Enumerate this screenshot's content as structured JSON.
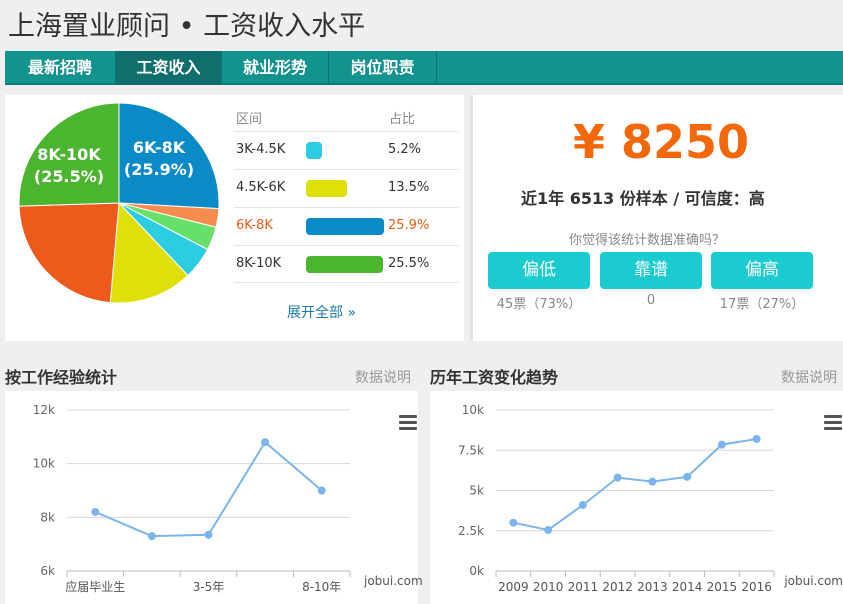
{
  "page": {
    "title": "上海置业顾问 • 工资收入水平"
  },
  "tabs": [
    {
      "label": "最新招聘",
      "active": false
    },
    {
      "label": "工资收入",
      "active": true
    },
    {
      "label": "就业形势",
      "active": false
    },
    {
      "label": "岗位职责",
      "active": false
    }
  ],
  "distribution": {
    "header_range": "区间",
    "header_pct": "占比",
    "rows": [
      {
        "label": "3K-4.5K",
        "pct": "5.2%",
        "value": 5.2,
        "color": "#2ccde0",
        "highlight": false
      },
      {
        "label": "4.5K-6K",
        "pct": "13.5%",
        "value": 13.5,
        "color": "#dfe00a",
        "highlight": false
      },
      {
        "label": "6K-8K",
        "pct": "25.9%",
        "value": 25.9,
        "color": "#0a8ac7",
        "highlight": true
      },
      {
        "label": "8K-10K",
        "pct": "25.5%",
        "value": 25.5,
        "color": "#4bb52f",
        "highlight": false
      }
    ],
    "expand_link": "展开全部 »"
  },
  "chart_data": [
    {
      "type": "pie",
      "slices": [
        {
          "label": "6K-8K",
          "value": 25.9,
          "color": "#0a8ac7"
        },
        {
          "label": "",
          "value": 3.0,
          "color": "#f88c4e"
        },
        {
          "label": "",
          "value": 3.8,
          "color": "#67e06a"
        },
        {
          "label": "3K-4.5K",
          "value": 5.2,
          "color": "#2ccde0"
        },
        {
          "label": "4.5K-6K",
          "value": 13.5,
          "color": "#dfe00a"
        },
        {
          "label": "",
          "value": 23.1,
          "color": "#ed5a1c"
        },
        {
          "label": "8K-10K",
          "value": 25.5,
          "color": "#4bb52f"
        }
      ],
      "data_labels": [
        {
          "line1": "6K-8K",
          "line2": "(25.9%)"
        },
        {
          "line1": "8K-10K",
          "line2": "(25.5%)"
        }
      ]
    },
    {
      "type": "line",
      "title": "按工作经验统计",
      "categories": [
        "应届毕业生",
        "",
        "3-5年",
        "",
        "8-10年"
      ],
      "values": [
        8200,
        7300,
        7350,
        10800,
        9000
      ],
      "ylim": [
        6000,
        12000
      ],
      "yticks": [
        6000,
        8000,
        10000,
        12000
      ],
      "ytick_labels": [
        "6k",
        "8k",
        "10k",
        "12k"
      ],
      "color": "#7cb5ec",
      "grid": true
    },
    {
      "type": "line",
      "title": "历年工资变化趋势",
      "categories": [
        "2009",
        "2010",
        "2011",
        "2012",
        "2013",
        "2014",
        "2015",
        "2016"
      ],
      "values": [
        3000,
        2550,
        4100,
        5800,
        5550,
        5850,
        7850,
        8200
      ],
      "ylim": [
        0,
        10000
      ],
      "yticks": [
        0,
        2500,
        5000,
        7500,
        10000
      ],
      "ytick_labels": [
        "0k",
        "2.5k",
        "5k",
        "7.5k",
        "10k"
      ],
      "color": "#7cb5ec",
      "grid": true
    }
  ],
  "summary": {
    "salary": "¥ 8250",
    "sample_text": "近1年 6513 份样本 / 可信度：高",
    "question": "你觉得该统计数据准确吗？",
    "votes": [
      {
        "label": "偏低",
        "count": "45票（73%）"
      },
      {
        "label": "靠谱",
        "count": "0"
      },
      {
        "label": "偏高",
        "count": "17票（27%）"
      }
    ]
  },
  "experience_section": {
    "title": "按工作经验统计",
    "link": "数据说明"
  },
  "trend_section": {
    "title": "历年工资变化趋势",
    "link": "数据说明"
  },
  "watermark": "jobui.com",
  "icons": {
    "chart_menu": "hamburger-menu-icon"
  }
}
